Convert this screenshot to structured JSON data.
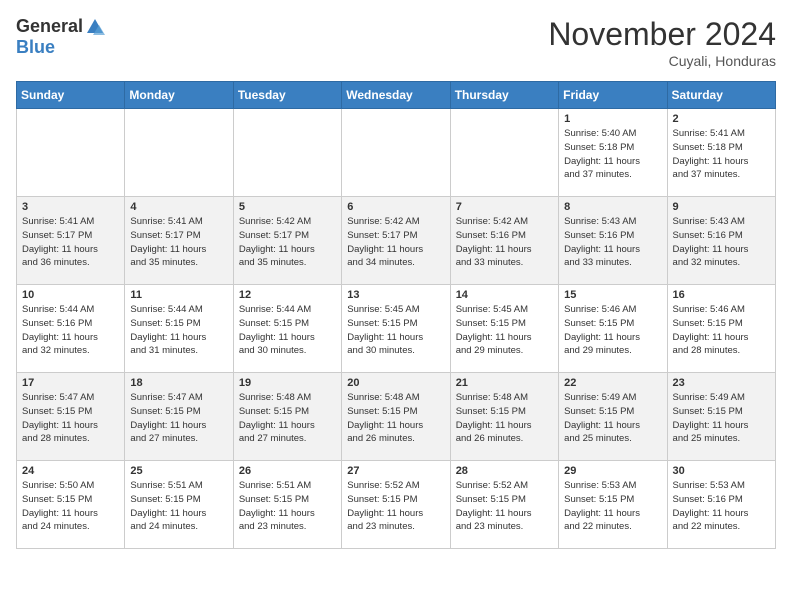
{
  "header": {
    "logo_general": "General",
    "logo_blue": "Blue",
    "month_title": "November 2024",
    "location": "Cuyali, Honduras"
  },
  "weekdays": [
    "Sunday",
    "Monday",
    "Tuesday",
    "Wednesday",
    "Thursday",
    "Friday",
    "Saturday"
  ],
  "weeks": [
    [
      {
        "day": "",
        "info": ""
      },
      {
        "day": "",
        "info": ""
      },
      {
        "day": "",
        "info": ""
      },
      {
        "day": "",
        "info": ""
      },
      {
        "day": "",
        "info": ""
      },
      {
        "day": "1",
        "info": "Sunrise: 5:40 AM\nSunset: 5:18 PM\nDaylight: 11 hours\nand 37 minutes."
      },
      {
        "day": "2",
        "info": "Sunrise: 5:41 AM\nSunset: 5:18 PM\nDaylight: 11 hours\nand 37 minutes."
      }
    ],
    [
      {
        "day": "3",
        "info": "Sunrise: 5:41 AM\nSunset: 5:17 PM\nDaylight: 11 hours\nand 36 minutes."
      },
      {
        "day": "4",
        "info": "Sunrise: 5:41 AM\nSunset: 5:17 PM\nDaylight: 11 hours\nand 35 minutes."
      },
      {
        "day": "5",
        "info": "Sunrise: 5:42 AM\nSunset: 5:17 PM\nDaylight: 11 hours\nand 35 minutes."
      },
      {
        "day": "6",
        "info": "Sunrise: 5:42 AM\nSunset: 5:17 PM\nDaylight: 11 hours\nand 34 minutes."
      },
      {
        "day": "7",
        "info": "Sunrise: 5:42 AM\nSunset: 5:16 PM\nDaylight: 11 hours\nand 33 minutes."
      },
      {
        "day": "8",
        "info": "Sunrise: 5:43 AM\nSunset: 5:16 PM\nDaylight: 11 hours\nand 33 minutes."
      },
      {
        "day": "9",
        "info": "Sunrise: 5:43 AM\nSunset: 5:16 PM\nDaylight: 11 hours\nand 32 minutes."
      }
    ],
    [
      {
        "day": "10",
        "info": "Sunrise: 5:44 AM\nSunset: 5:16 PM\nDaylight: 11 hours\nand 32 minutes."
      },
      {
        "day": "11",
        "info": "Sunrise: 5:44 AM\nSunset: 5:15 PM\nDaylight: 11 hours\nand 31 minutes."
      },
      {
        "day": "12",
        "info": "Sunrise: 5:44 AM\nSunset: 5:15 PM\nDaylight: 11 hours\nand 30 minutes."
      },
      {
        "day": "13",
        "info": "Sunrise: 5:45 AM\nSunset: 5:15 PM\nDaylight: 11 hours\nand 30 minutes."
      },
      {
        "day": "14",
        "info": "Sunrise: 5:45 AM\nSunset: 5:15 PM\nDaylight: 11 hours\nand 29 minutes."
      },
      {
        "day": "15",
        "info": "Sunrise: 5:46 AM\nSunset: 5:15 PM\nDaylight: 11 hours\nand 29 minutes."
      },
      {
        "day": "16",
        "info": "Sunrise: 5:46 AM\nSunset: 5:15 PM\nDaylight: 11 hours\nand 28 minutes."
      }
    ],
    [
      {
        "day": "17",
        "info": "Sunrise: 5:47 AM\nSunset: 5:15 PM\nDaylight: 11 hours\nand 28 minutes."
      },
      {
        "day": "18",
        "info": "Sunrise: 5:47 AM\nSunset: 5:15 PM\nDaylight: 11 hours\nand 27 minutes."
      },
      {
        "day": "19",
        "info": "Sunrise: 5:48 AM\nSunset: 5:15 PM\nDaylight: 11 hours\nand 27 minutes."
      },
      {
        "day": "20",
        "info": "Sunrise: 5:48 AM\nSunset: 5:15 PM\nDaylight: 11 hours\nand 26 minutes."
      },
      {
        "day": "21",
        "info": "Sunrise: 5:48 AM\nSunset: 5:15 PM\nDaylight: 11 hours\nand 26 minutes."
      },
      {
        "day": "22",
        "info": "Sunrise: 5:49 AM\nSunset: 5:15 PM\nDaylight: 11 hours\nand 25 minutes."
      },
      {
        "day": "23",
        "info": "Sunrise: 5:49 AM\nSunset: 5:15 PM\nDaylight: 11 hours\nand 25 minutes."
      }
    ],
    [
      {
        "day": "24",
        "info": "Sunrise: 5:50 AM\nSunset: 5:15 PM\nDaylight: 11 hours\nand 24 minutes."
      },
      {
        "day": "25",
        "info": "Sunrise: 5:51 AM\nSunset: 5:15 PM\nDaylight: 11 hours\nand 24 minutes."
      },
      {
        "day": "26",
        "info": "Sunrise: 5:51 AM\nSunset: 5:15 PM\nDaylight: 11 hours\nand 23 minutes."
      },
      {
        "day": "27",
        "info": "Sunrise: 5:52 AM\nSunset: 5:15 PM\nDaylight: 11 hours\nand 23 minutes."
      },
      {
        "day": "28",
        "info": "Sunrise: 5:52 AM\nSunset: 5:15 PM\nDaylight: 11 hours\nand 23 minutes."
      },
      {
        "day": "29",
        "info": "Sunrise: 5:53 AM\nSunset: 5:15 PM\nDaylight: 11 hours\nand 22 minutes."
      },
      {
        "day": "30",
        "info": "Sunrise: 5:53 AM\nSunset: 5:16 PM\nDaylight: 11 hours\nand 22 minutes."
      }
    ]
  ]
}
